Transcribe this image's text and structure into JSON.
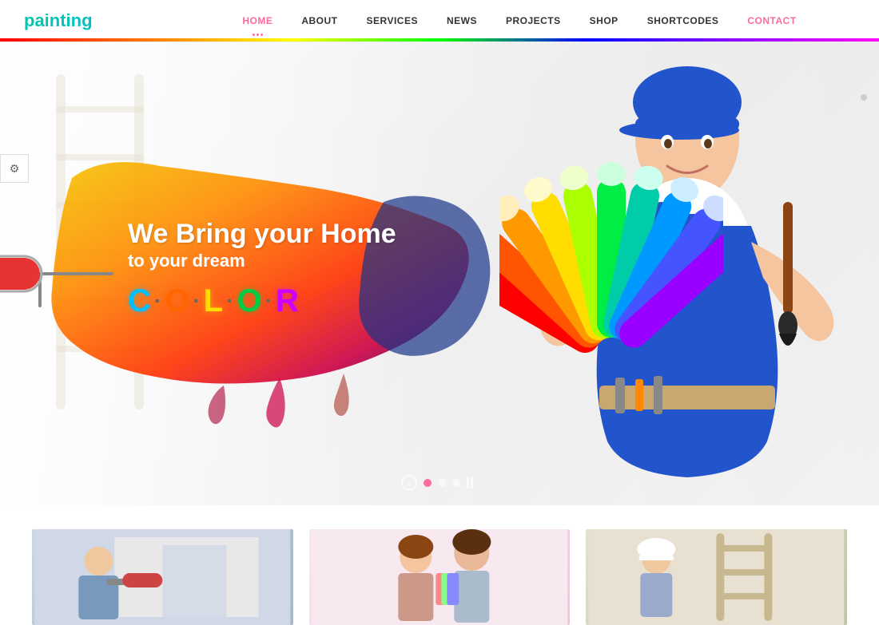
{
  "site": {
    "logo": "painting",
    "nav": {
      "items": [
        {
          "label": "HOME",
          "active": true,
          "has_dots": true
        },
        {
          "label": "ABOUT",
          "active": false
        },
        {
          "label": "SERVICES",
          "active": false
        },
        {
          "label": "NEWS",
          "active": false
        },
        {
          "label": "PROJECTS",
          "active": false
        },
        {
          "label": "SHOP",
          "active": false
        },
        {
          "label": "SHORTCODES",
          "active": false
        },
        {
          "label": "CONTACT",
          "active": false
        }
      ]
    }
  },
  "hero": {
    "title_line1": "We Bring your Home",
    "title_line2": "to your dream",
    "color_word": {
      "letters": [
        "C",
        "·",
        "O",
        "·",
        "L",
        "·",
        "O",
        "·",
        "R"
      ],
      "colors": [
        "#00bfff",
        "#888",
        "#ff6600",
        "#888",
        "#ffdd00",
        "#888",
        "#00cc44",
        "#888",
        "#cc00ff"
      ]
    },
    "slider": {
      "dots": 3,
      "active_dot": 0
    }
  },
  "cards": [
    {
      "id": 1,
      "bg": "card-img-1"
    },
    {
      "id": 2,
      "bg": "card-img-2"
    },
    {
      "id": 3,
      "bg": "card-img-3"
    }
  ],
  "icons": {
    "settings": "⚙",
    "arrow_right": "›",
    "pause_bar": "||"
  }
}
